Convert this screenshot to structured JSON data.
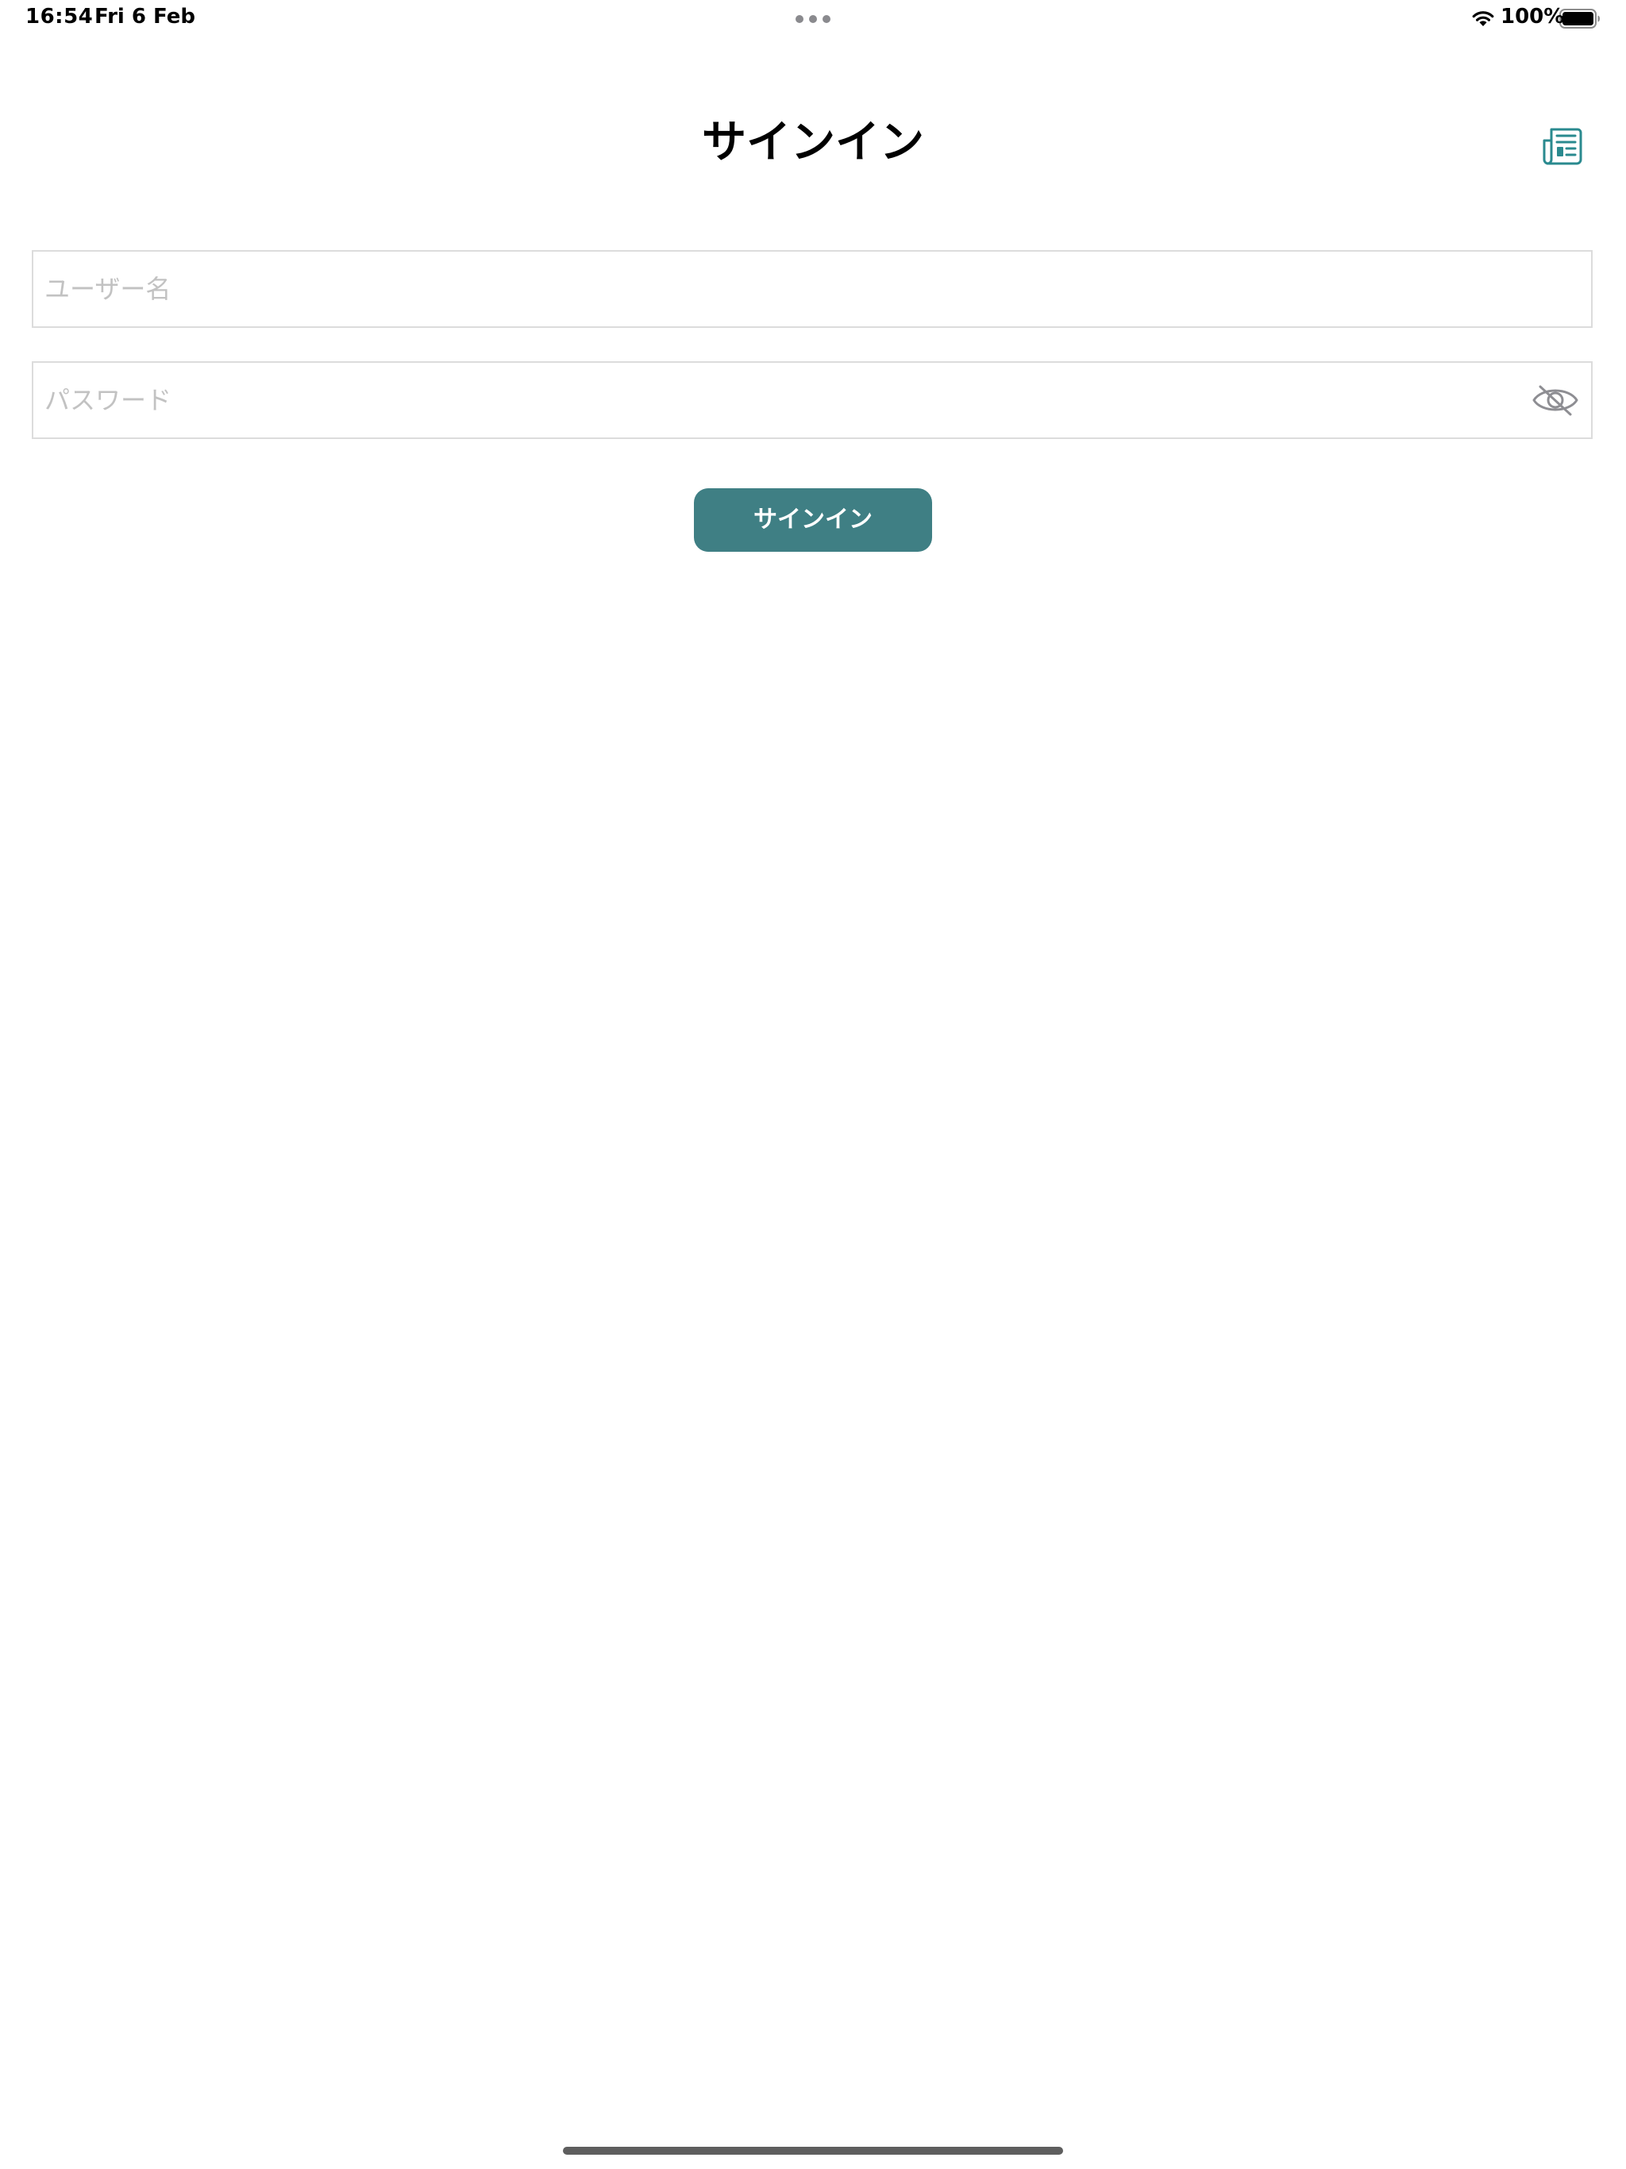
{
  "status_bar": {
    "time": "16:54",
    "date": "Fri 6 Feb",
    "battery_percent": "100%",
    "battery_level": 1.0,
    "icons": [
      "multitask-dots-icon",
      "wifi-icon",
      "battery-icon"
    ]
  },
  "header": {
    "title": "サインイン",
    "action_icon": "newspaper-icon"
  },
  "form": {
    "username_placeholder": "ユーザー名",
    "username_value": "",
    "password_placeholder": "パスワード",
    "password_value": "",
    "password_toggle_icon": "eye-slash-icon",
    "submit_label": "サインイン"
  },
  "colors": {
    "accent": "#3f7f84",
    "icon_teal": "#2a8a8f",
    "placeholder": "#c2c2c2",
    "field_border": "#dcdcdc"
  }
}
